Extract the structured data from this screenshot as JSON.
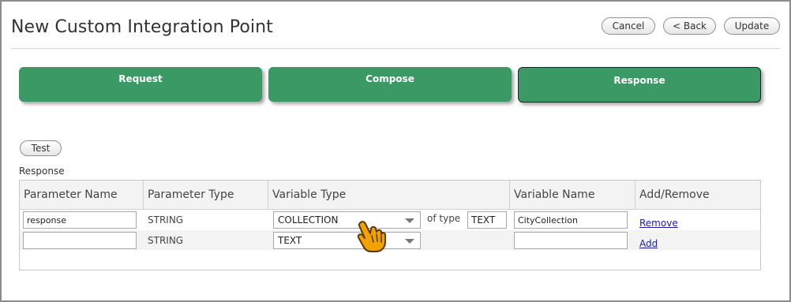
{
  "page": {
    "title": "New Custom Integration Point"
  },
  "header_buttons": {
    "cancel": "Cancel",
    "back": "< Back",
    "update": "Update"
  },
  "steps": [
    {
      "label": "Request",
      "active": false
    },
    {
      "label": "Compose",
      "active": false
    },
    {
      "label": "Response",
      "active": true
    }
  ],
  "test_button": "Test",
  "section_label": "Response",
  "table": {
    "headers": [
      "Parameter Name",
      "Parameter Type",
      "Variable Type",
      "Variable Name",
      "Add/Remove"
    ],
    "rows": [
      {
        "parameter_name": "response",
        "parameter_type": "STRING",
        "variable_type": "COLLECTION",
        "of_type_label": "of type",
        "of_type_value": "TEXT",
        "variable_name": "CityCollection",
        "action": "Remove"
      },
      {
        "parameter_name": "",
        "parameter_type": "STRING",
        "variable_type": "TEXT",
        "variable_name": "",
        "action": "Add"
      }
    ]
  },
  "colors": {
    "step_green": "#3a9964",
    "link_blue": "#1a1aa6",
    "cursor_orange": "#f2a200"
  },
  "icons": {
    "cursor": "hand-pointer-icon"
  }
}
